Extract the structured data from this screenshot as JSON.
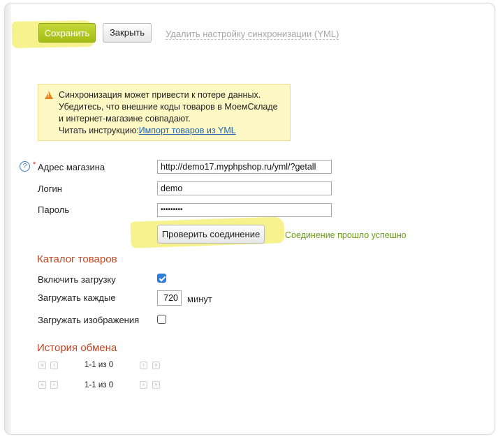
{
  "toolbar": {
    "save_label": "Сохранить",
    "close_label": "Закрыть",
    "delete_link": "Удалить настройку синхронизации (YML)"
  },
  "warning": {
    "line1": "Синхронизация может привести к потере данных.",
    "line2": "Убедитесь, что внешние коды товаров в МоемСкладе",
    "line3": "и интернет-магазине совпадают.",
    "line4_prefix": "Читать инструкцию:",
    "link_text": "Импорт товаров из YML"
  },
  "form": {
    "help_icon": "?",
    "required_mark": "*",
    "shop_address_label": "Адрес магазина",
    "shop_address_value": "http://demo17.myphpshop.ru/yml/?getall",
    "login_label": "Логин",
    "login_value": "demo",
    "password_label": "Пароль",
    "password_value": "•••••••••",
    "check_button": "Проверить соединение",
    "check_status": "Соединение прошло успешно"
  },
  "catalog": {
    "title": "Каталог товаров",
    "enable_label": "Включить загрузку",
    "enable_checked": true,
    "interval_label": "Загружать каждые",
    "interval_value": "720",
    "interval_unit": "минут",
    "images_label": "Загружать изображения",
    "images_checked": false
  },
  "history": {
    "title": "История обмена",
    "pager_top": "1-1 из 0",
    "pager_bottom": "1-1 из 0"
  },
  "colors": {
    "accent_green": "#a3bd13",
    "section_red": "#c44420",
    "success_green": "#6c9b16",
    "highlight_yellow": "#f4f07a"
  }
}
